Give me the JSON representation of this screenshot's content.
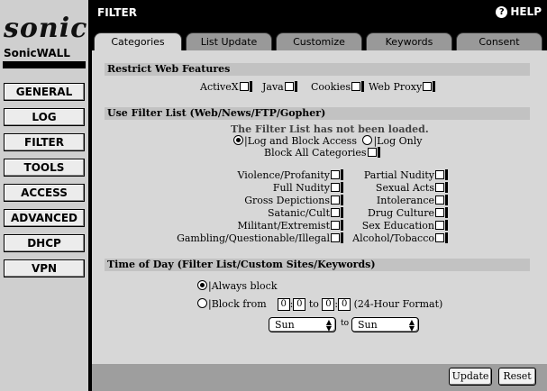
{
  "sidebar": {
    "logo": "sonic",
    "brand": "SonicWALL",
    "nav": [
      "GENERAL",
      "LOG",
      "FILTER",
      "TOOLS",
      "ACCESS",
      "ADVANCED",
      "DHCP",
      "VPN"
    ]
  },
  "header": {
    "title": "FILTER",
    "help": "HELP",
    "help_icon": "?"
  },
  "tabs": [
    "Categories",
    "List Update",
    "Customize",
    "Keywords",
    "Consent"
  ],
  "restrict": {
    "heading": "Restrict Web Features",
    "items": [
      "ActiveX",
      "Java",
      "Cookies",
      "Web Proxy"
    ]
  },
  "filter_list": {
    "heading": "Use Filter List (Web/News/FTP/Gopher)",
    "status": "The Filter List has not been loaded.",
    "mode_log_block": "|Log and Block Access",
    "mode_log_only": "|Log Only",
    "block_all": "Block All Categories",
    "left_categories": [
      "Violence/Profanity",
      "Full Nudity",
      "Gross Depictions",
      "Satanic/Cult",
      "Militant/Extremist",
      "Gambling/Questionable/Illegal"
    ],
    "right_categories": [
      "Partial Nudity",
      "Sexual Acts",
      "Intolerance",
      "Drug Culture",
      "Sex Education",
      "Alcohol/Tobacco"
    ]
  },
  "time_of_day": {
    "heading": "Time of Day (Filter List/Custom Sites/Keywords)",
    "always_block": "|Always block",
    "block_from": "|Block from",
    "from_h": "0",
    "from_m": "0",
    "to_word": "to",
    "to_h": "0",
    "to_m": "0",
    "format": "(24-Hour Format)",
    "day_from": "Sun",
    "day_to_word": "to",
    "day_to": "Sun"
  },
  "footer": {
    "update": "Update",
    "reset": "Reset"
  }
}
